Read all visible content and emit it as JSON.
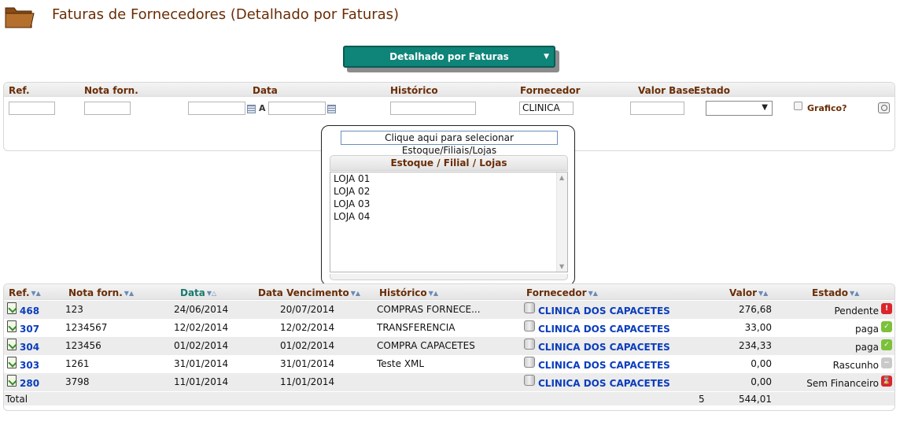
{
  "header": {
    "title": "Faturas de Fornecedores (Detalhado por Faturas)",
    "icon": "folder-icon"
  },
  "mode_select": {
    "value": "Detalhado por Faturas"
  },
  "filters": {
    "labels": {
      "ref": "Ref.",
      "nota": "Nota forn.",
      "data": "Data",
      "historico": "Histórico",
      "fornecedor": "Fornecedor",
      "valor_base": "Valor Base",
      "estado": "Estado"
    },
    "values": {
      "ref": "",
      "nota": "",
      "data_de": "",
      "data_ate": "",
      "historico": "",
      "fornecedor": "CLINICA",
      "valor_base": "",
      "estado": ""
    },
    "date_separator": "A",
    "grafico_label": "Grafico?"
  },
  "store_picker": {
    "button_label": "Clique aqui para selecionar Estoque/Filiais/Lojas",
    "title": "Estoque / Filial / Lojas",
    "items": [
      "LOJA 01",
      "LOJA 02",
      "LOJA 03",
      "LOJA 04"
    ]
  },
  "grid": {
    "columns": {
      "ref": "Ref.",
      "nota": "Nota forn.",
      "data": "Data",
      "vencimento": "Data Vencimento",
      "historico": "Histórico",
      "fornecedor": "Fornecedor",
      "valor": "Valor",
      "estado": "Estado"
    },
    "rows": [
      {
        "ref": "468",
        "nota": "123",
        "data": "24/06/2014",
        "vencimento": "20/07/2014",
        "historico": "COMPRAS FORNECE...",
        "fornecedor": "CLINICA DOS CAPACETES",
        "valor": "276,68",
        "estado": "Pendente",
        "status_icon": "alert-icon",
        "status_color": "#d9262c",
        "status_glyph": "!"
      },
      {
        "ref": "307",
        "nota": "1234567",
        "data": "12/02/2014",
        "vencimento": "12/02/2014",
        "historico": "TRANSFERENCIA",
        "fornecedor": "CLINICA DOS CAPACETES",
        "valor": "33,00",
        "estado": "paga",
        "status_icon": "check-icon",
        "status_color": "#7cc13a",
        "status_glyph": "✓"
      },
      {
        "ref": "304",
        "nota": "123456",
        "data": "01/02/2014",
        "vencimento": "01/02/2014",
        "historico": "COMPRA CAPACETES",
        "fornecedor": "CLINICA DOS CAPACETES",
        "valor": "234,33",
        "estado": "paga",
        "status_icon": "check-icon",
        "status_color": "#7cc13a",
        "status_glyph": "✓"
      },
      {
        "ref": "303",
        "nota": "1261",
        "data": "31/01/2014",
        "vencimento": "31/01/2014",
        "historico": "Teste XML",
        "fornecedor": "CLINICA DOS CAPACETES",
        "valor": "0,00",
        "estado": "Rascunho",
        "status_icon": "draft-icon",
        "status_color": "#c9c9c9",
        "status_glyph": "−"
      },
      {
        "ref": "280",
        "nota": "3798",
        "data": "11/01/2014",
        "vencimento": "11/01/2014",
        "historico": "",
        "fornecedor": "CLINICA DOS CAPACETES",
        "valor": "0,00",
        "estado": "Sem Financeiro",
        "status_icon": "no-finance-icon",
        "status_color": "#d9262c",
        "status_glyph": "⌛"
      }
    ],
    "total": {
      "label": "Total",
      "count": "5",
      "valor": "544,01"
    }
  },
  "colors": {
    "title": "#6a2d06",
    "teal": "#0f8479",
    "link": "#0a3dbd"
  }
}
